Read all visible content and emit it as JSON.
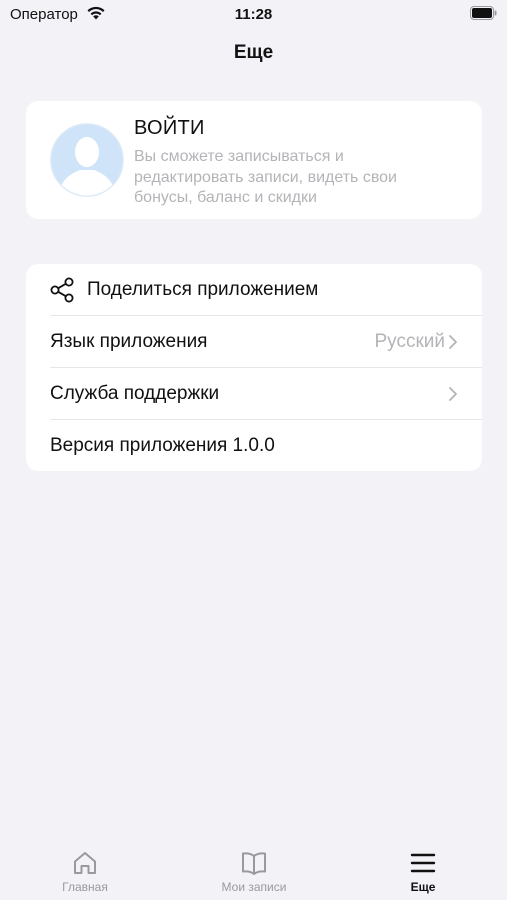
{
  "status_bar": {
    "carrier": "Оператор",
    "time": "11:28",
    "icons": [
      "wifi-icon",
      "battery-icon"
    ]
  },
  "nav": {
    "title": "Еще"
  },
  "login_card": {
    "title": "ВОЙТИ",
    "description": "Вы сможете записываться и редактировать записи, видеть свои бонусы, баланс и скидки",
    "icon": "avatar-placeholder-icon"
  },
  "menu": {
    "share": {
      "label": "Поделиться приложением",
      "icon": "share-icon"
    },
    "language": {
      "label": "Язык приложения",
      "value": "Русский"
    },
    "support": {
      "label": "Служба поддержки"
    },
    "version": {
      "label": "Версия приложения 1.0.0"
    }
  },
  "tab_bar": {
    "home": {
      "label": "Главная",
      "icon": "home-icon"
    },
    "bookings": {
      "label": "Мои записи",
      "icon": "book-icon"
    },
    "more": {
      "label": "Еще",
      "icon": "menu-icon",
      "active": true
    }
  },
  "colors": {
    "background": "#f2f2f7",
    "card": "#ffffff",
    "secondary_text": "#b4b4b8",
    "avatar": "#cfe4f9"
  }
}
